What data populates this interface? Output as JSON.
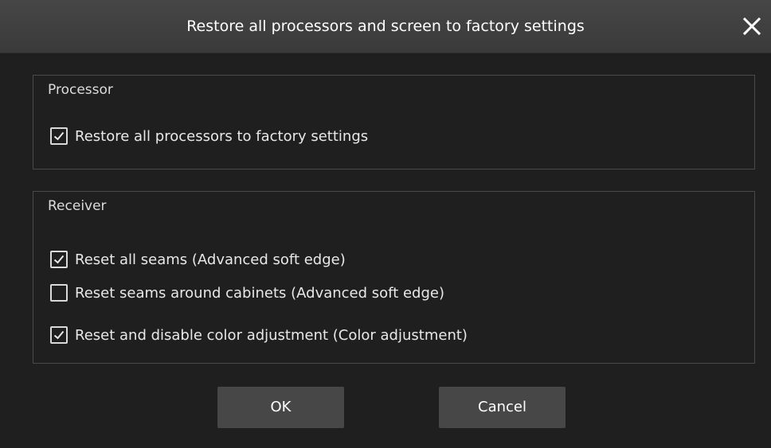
{
  "dialog": {
    "title": "Restore all processors and screen to factory settings",
    "close_icon": "close-icon"
  },
  "processor": {
    "title": "Processor",
    "options": [
      {
        "label": "Restore all processors to factory settings",
        "checked": true
      }
    ]
  },
  "receiver": {
    "title": "Receiver",
    "options": [
      {
        "label": "Reset all seams (Advanced soft edge)",
        "checked": true
      },
      {
        "label": "Reset seams around cabinets (Advanced soft edge)",
        "checked": false
      },
      {
        "label": "Reset and disable color adjustment (Color adjustment)",
        "checked": true
      }
    ]
  },
  "buttons": {
    "ok": "OK",
    "cancel": "Cancel"
  },
  "colors": {
    "background": "#1f1f1f",
    "titlebar": "#3f3f3f",
    "button": "#474747",
    "text": "#e8e8e8"
  }
}
